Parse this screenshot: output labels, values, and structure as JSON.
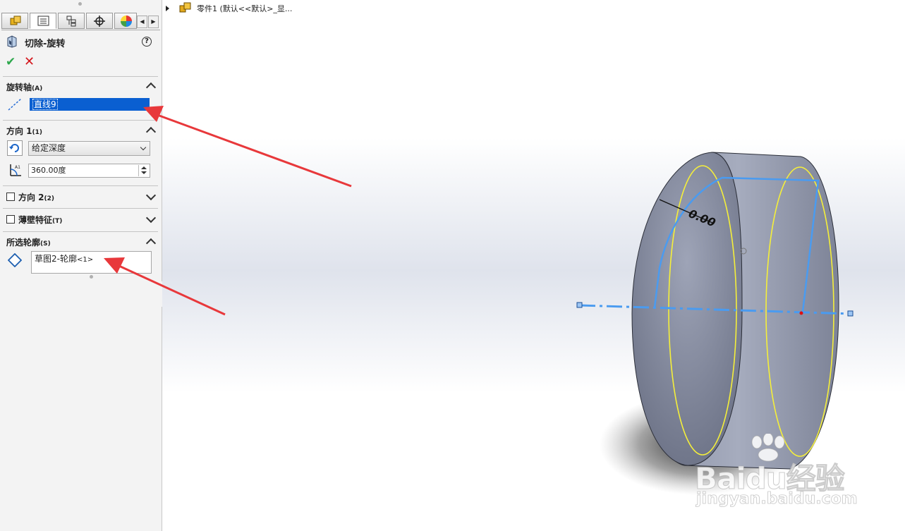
{
  "panel": {
    "tabs": [
      "feature-manager-tab",
      "property-manager-tab",
      "configuration-manager-tab",
      "dimxpert-tab",
      "display-manager-tab"
    ],
    "title": "切除-旋转",
    "help": "?",
    "ok": "✔",
    "cancel": "✕",
    "sections": {
      "axis": {
        "title": "旋转轴",
        "accel": "(A)",
        "value": "直线9"
      },
      "dir1": {
        "title": "方向 1",
        "accel": "(1)",
        "end_condition": "给定深度",
        "angle": "360.00度"
      },
      "dir2": {
        "title": "方向 2",
        "accel": "(2)"
      },
      "thin": {
        "title": "薄壁特征",
        "accel": "(T)"
      },
      "contours": {
        "title": "所选轮廓",
        "accel": "(S)",
        "item_main": "草图2-轮廓",
        "item_tag": "<1>"
      }
    }
  },
  "tree": {
    "label": "零件1 (默认<<默认>_显..."
  },
  "viewport": {
    "dimension_label": "0.00"
  },
  "watermark": {
    "brand": "Baidu经验",
    "url": "jingyan.baidu.com"
  },
  "colors": {
    "model": "#8c93a6",
    "sketch": "#4a9bf0",
    "edges": "#f5ef3a",
    "arrow": "#e8383b",
    "selection": "#0a5fd1"
  }
}
